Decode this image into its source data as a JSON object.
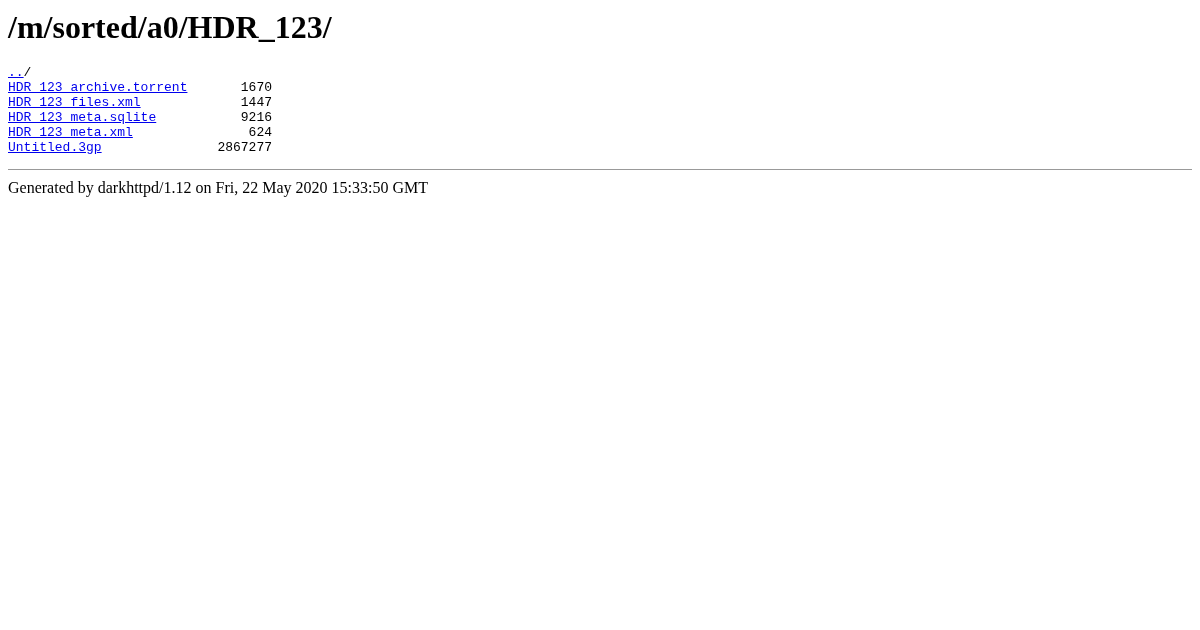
{
  "title": "/m/sorted/a0/HDR_123/",
  "parent": {
    "link": "..",
    "suffix": "/"
  },
  "files": [
    {
      "name": "HDR_123_archive.torrent",
      "size": "1670"
    },
    {
      "name": "HDR_123_files.xml",
      "size": "1447"
    },
    {
      "name": "HDR_123_meta.sqlite",
      "size": "9216"
    },
    {
      "name": "HDR_123_meta.xml",
      "size": "624"
    },
    {
      "name": "Untitled.3gp",
      "size": "2867277"
    }
  ],
  "footer": "Generated by darkhttpd/1.12 on Fri, 22 May 2020 15:33:50 GMT"
}
